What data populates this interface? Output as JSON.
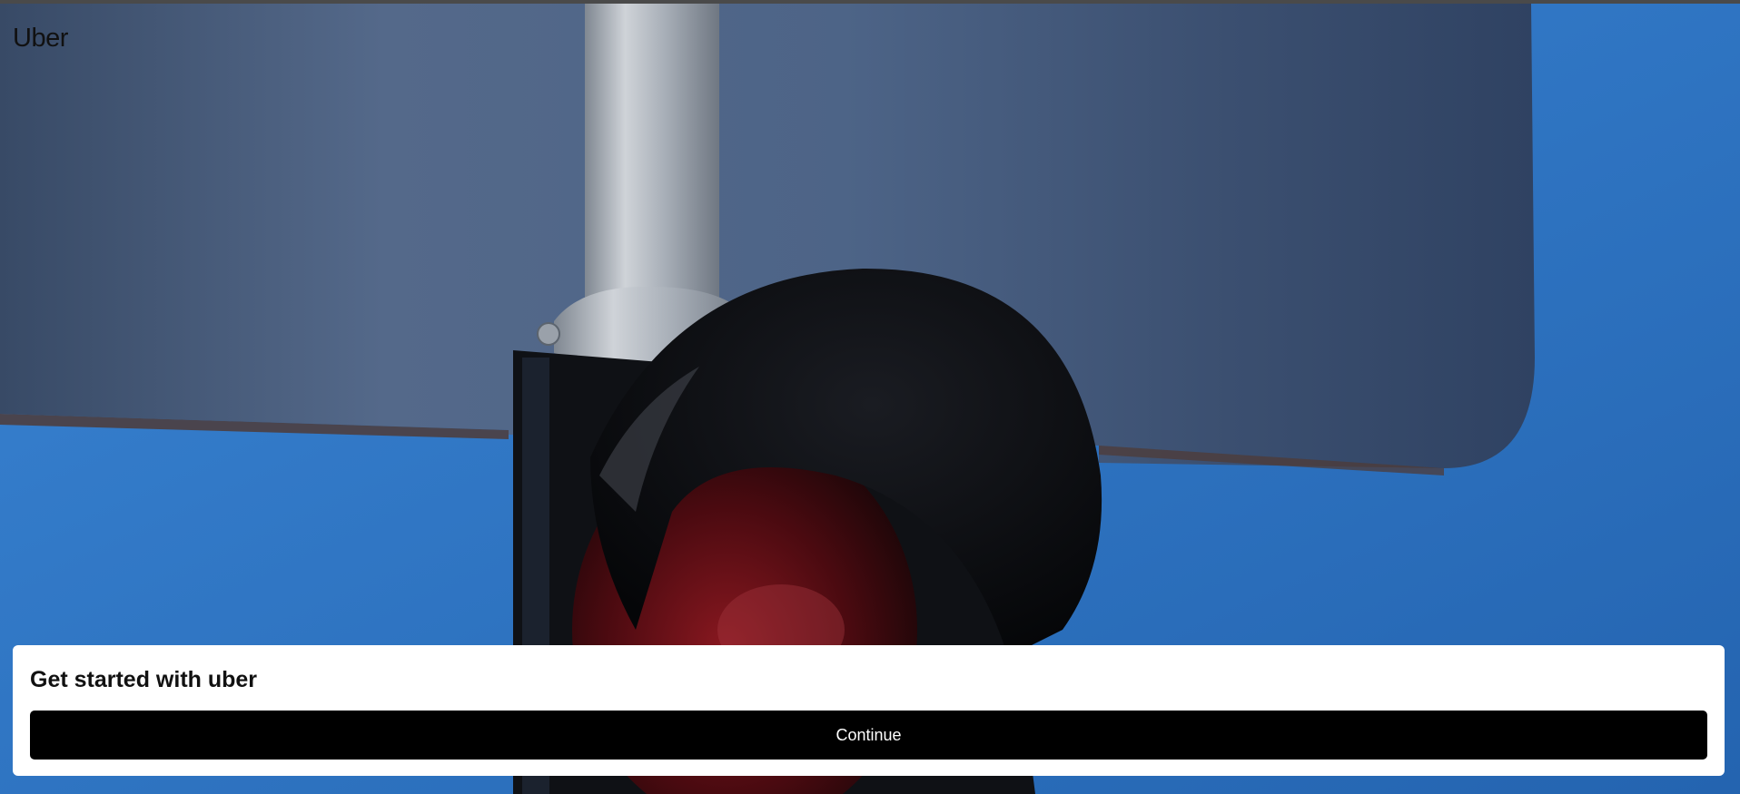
{
  "header": {
    "logo_text": "Uber"
  },
  "hero": {
    "image_subject": "traffic-light-on-pole-against-blue-sky",
    "colors": {
      "sky": "#2d74c2",
      "sign_panel": "#4b6283",
      "pole": "#b7bcc2",
      "signal_housing": "#0f1115",
      "red_lens": "#5a0c12"
    }
  },
  "card": {
    "title": "Get started with uber",
    "continue_label": "Continue"
  },
  "colors": {
    "button_bg": "#000000",
    "button_text": "#ffffff",
    "card_bg": "#ffffff",
    "logo": "#111111"
  }
}
